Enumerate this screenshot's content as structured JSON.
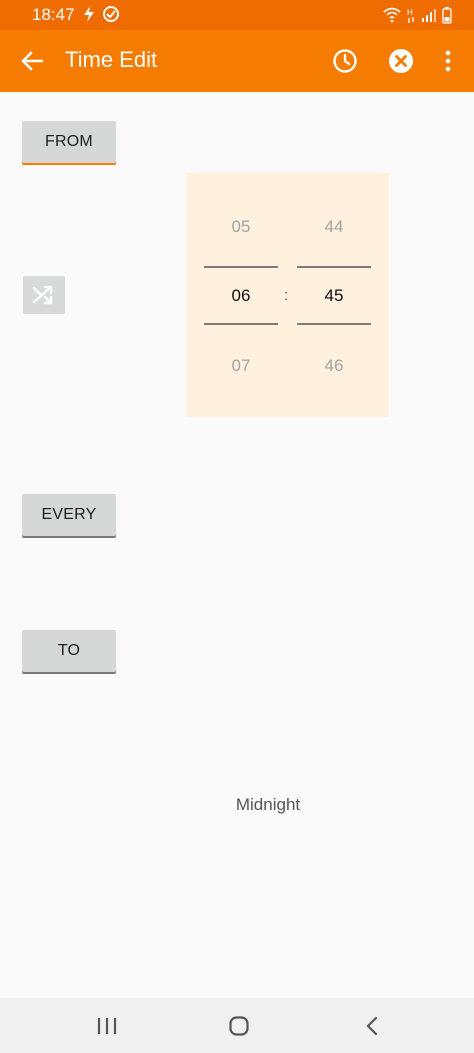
{
  "status_bar": {
    "time": "18:47",
    "background": "#ef6c00"
  },
  "app_bar": {
    "title": "Time Edit",
    "background": "#f57c00",
    "icons": [
      "arrow-back-icon",
      "clock-icon",
      "close-circle-icon",
      "more-vert-icon"
    ]
  },
  "buttons": {
    "from": "FROM",
    "every": "EVERY",
    "to": "TO"
  },
  "picker": {
    "hour_prev": "05",
    "hour_selected": "06",
    "hour_next": "07",
    "minute_prev": "44",
    "minute_selected": "45",
    "minute_next": "46",
    "separator": ":"
  },
  "label": {
    "midnight": "Midnight"
  },
  "nav": {
    "icons": [
      "recent-apps-icon",
      "home-icon",
      "back-icon"
    ]
  }
}
